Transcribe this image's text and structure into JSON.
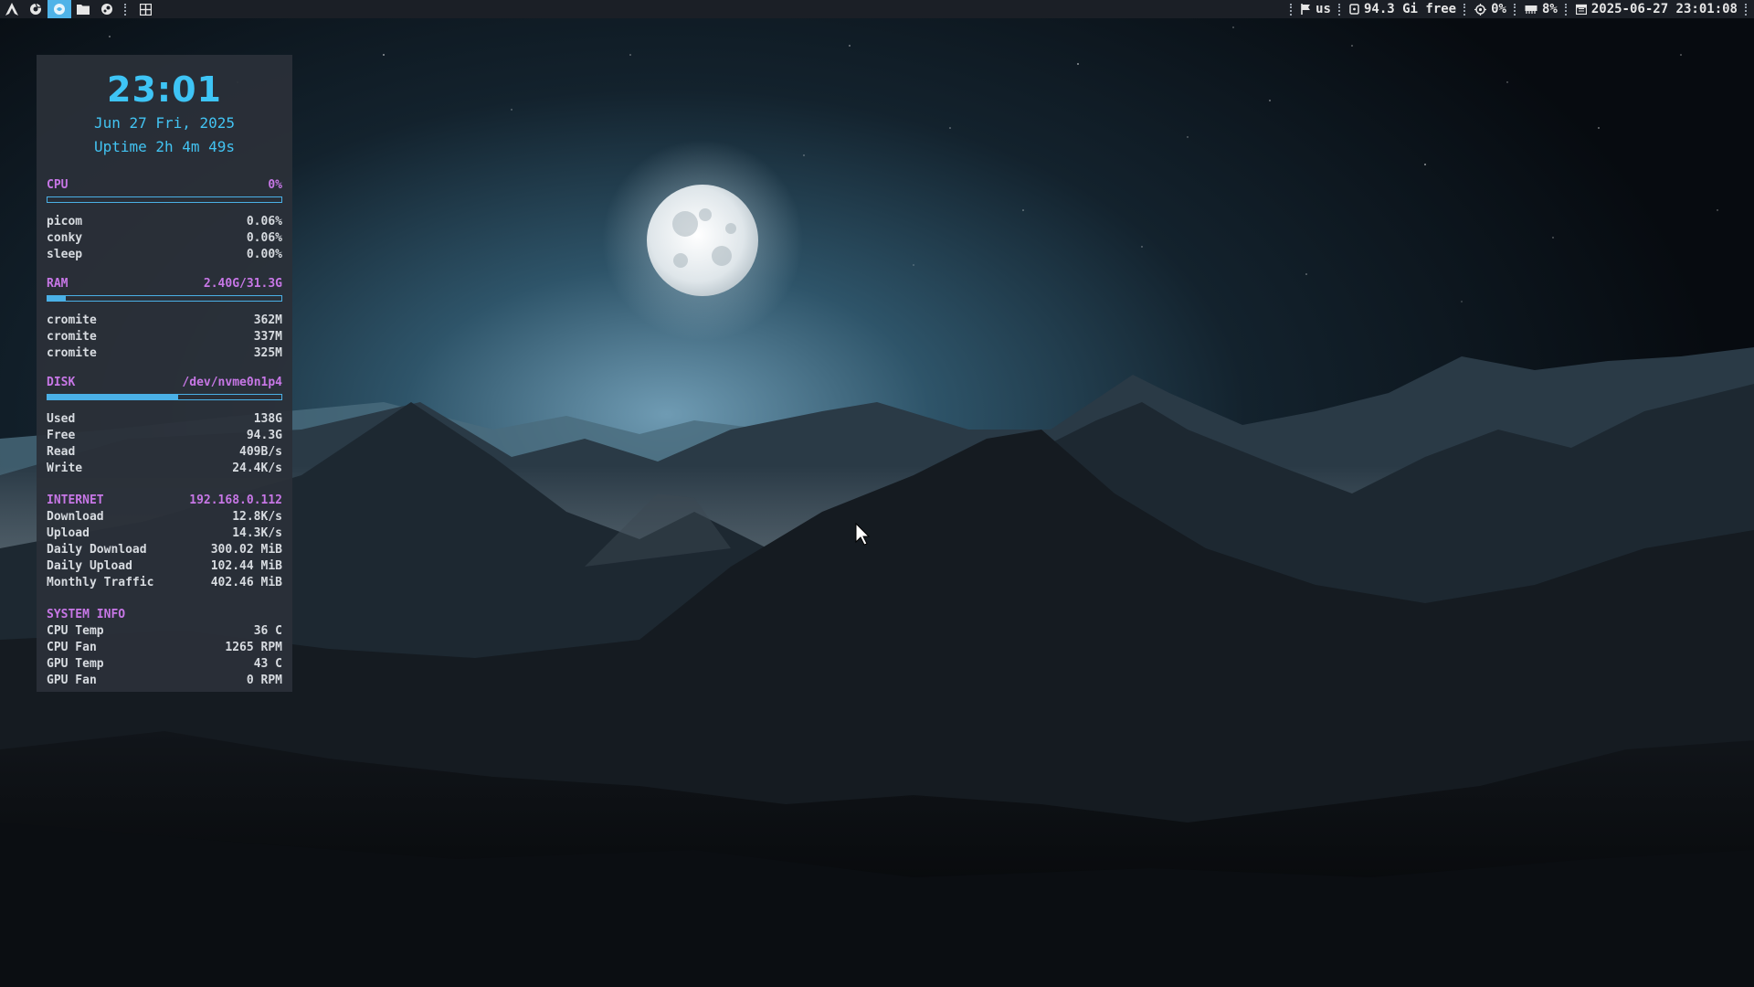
{
  "topbar": {
    "workspace_icons": [
      {
        "name": "arch-icon",
        "active": false
      },
      {
        "name": "browser-icon",
        "active": false
      },
      {
        "name": "app-icon",
        "active": true
      },
      {
        "name": "folder-icon",
        "active": false
      },
      {
        "name": "steam-icon",
        "active": false
      }
    ],
    "layout_icon": "grid-icon",
    "keyboard_layout": "us",
    "disk_free": "94.3 Gi free",
    "cpu_usage": "0%",
    "memory_usage": "8%",
    "datetime": "2025-06-27 23:01:08"
  },
  "conky": {
    "time": "23:01",
    "date": "Jun 27 Fri, 2025",
    "uptime": "Uptime 2h 4m 49s",
    "cpu": {
      "label": "CPU",
      "value": "0%",
      "fill": 0.0,
      "processes": [
        {
          "name": "picom",
          "value": "0.06%"
        },
        {
          "name": "conky",
          "value": "0.06%"
        },
        {
          "name": "sleep",
          "value": "0.00%"
        }
      ]
    },
    "ram": {
      "label": "RAM",
      "value": "2.40G/31.3G",
      "fill": 0.077,
      "processes": [
        {
          "name": "cromite",
          "value": "362M"
        },
        {
          "name": "cromite",
          "value": "337M"
        },
        {
          "name": "cromite",
          "value": "325M"
        }
      ]
    },
    "disk": {
      "label": "DISK",
      "value": "/dev/nvme0n1p4",
      "fill": 0.56,
      "rows": [
        {
          "name": "Used",
          "value": "138G"
        },
        {
          "name": "Free",
          "value": "94.3G"
        },
        {
          "name": "Read",
          "value": "409B/s"
        },
        {
          "name": "Write",
          "value": "24.4K/s"
        }
      ]
    },
    "internet": {
      "label": "INTERNET",
      "value": "192.168.0.112",
      "rows": [
        {
          "name": "Download",
          "value": "12.8K/s"
        },
        {
          "name": "Upload",
          "value": "14.3K/s"
        },
        {
          "name": "Daily Download",
          "value": "300.02 MiB"
        },
        {
          "name": "Daily Upload",
          "value": "102.44 MiB"
        },
        {
          "name": "Monthly Traffic",
          "value": "402.46 MiB"
        }
      ]
    },
    "sysinfo": {
      "label": "SYSTEM INFO",
      "rows": [
        {
          "name": "CPU Temp",
          "value": "36 C"
        },
        {
          "name": "CPU Fan",
          "value": "1265 RPM"
        },
        {
          "name": "GPU Temp",
          "value": "43 C"
        },
        {
          "name": "GPU Fan",
          "value": "0 RPM"
        }
      ]
    }
  },
  "colors": {
    "accent_blue": "#3ec4f5",
    "accent_purple": "#c777e6",
    "panel_bg": "#2b3038",
    "bar_bg": "#1b1f26"
  }
}
